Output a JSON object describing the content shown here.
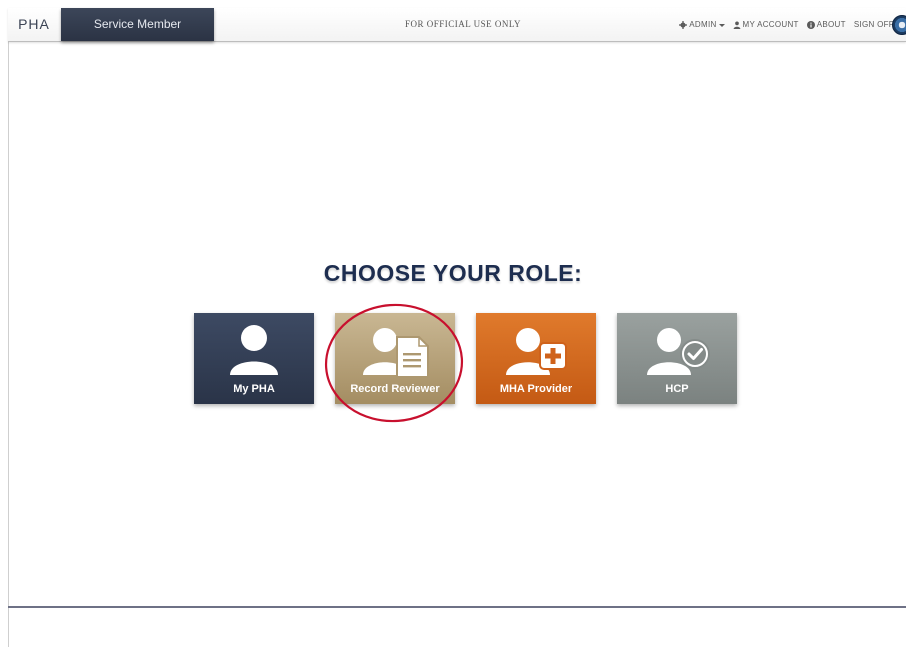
{
  "header": {
    "brand": "PHA",
    "active_role": "Service Member",
    "banner": "FOR OFFICIAL USE ONLY",
    "links": {
      "admin": "ADMIN",
      "my_account": "MY ACCOUNT",
      "about": "ABOUT",
      "sign_off": "SIGN OFF"
    }
  },
  "main": {
    "heading": "CHOOSE YOUR ROLE:",
    "roles": [
      {
        "label": "My PHA",
        "color": "#2f3a4f",
        "icon": "user-icon"
      },
      {
        "label": "Record Reviewer",
        "color": "#b7a47c",
        "icon": "user-document-icon"
      },
      {
        "label": "MHA Provider",
        "color": "#d2661e",
        "icon": "user-plus-icon"
      },
      {
        "label": "HCP",
        "color": "#878e8c",
        "icon": "user-check-icon"
      }
    ],
    "highlight_color": "#c8102e"
  }
}
